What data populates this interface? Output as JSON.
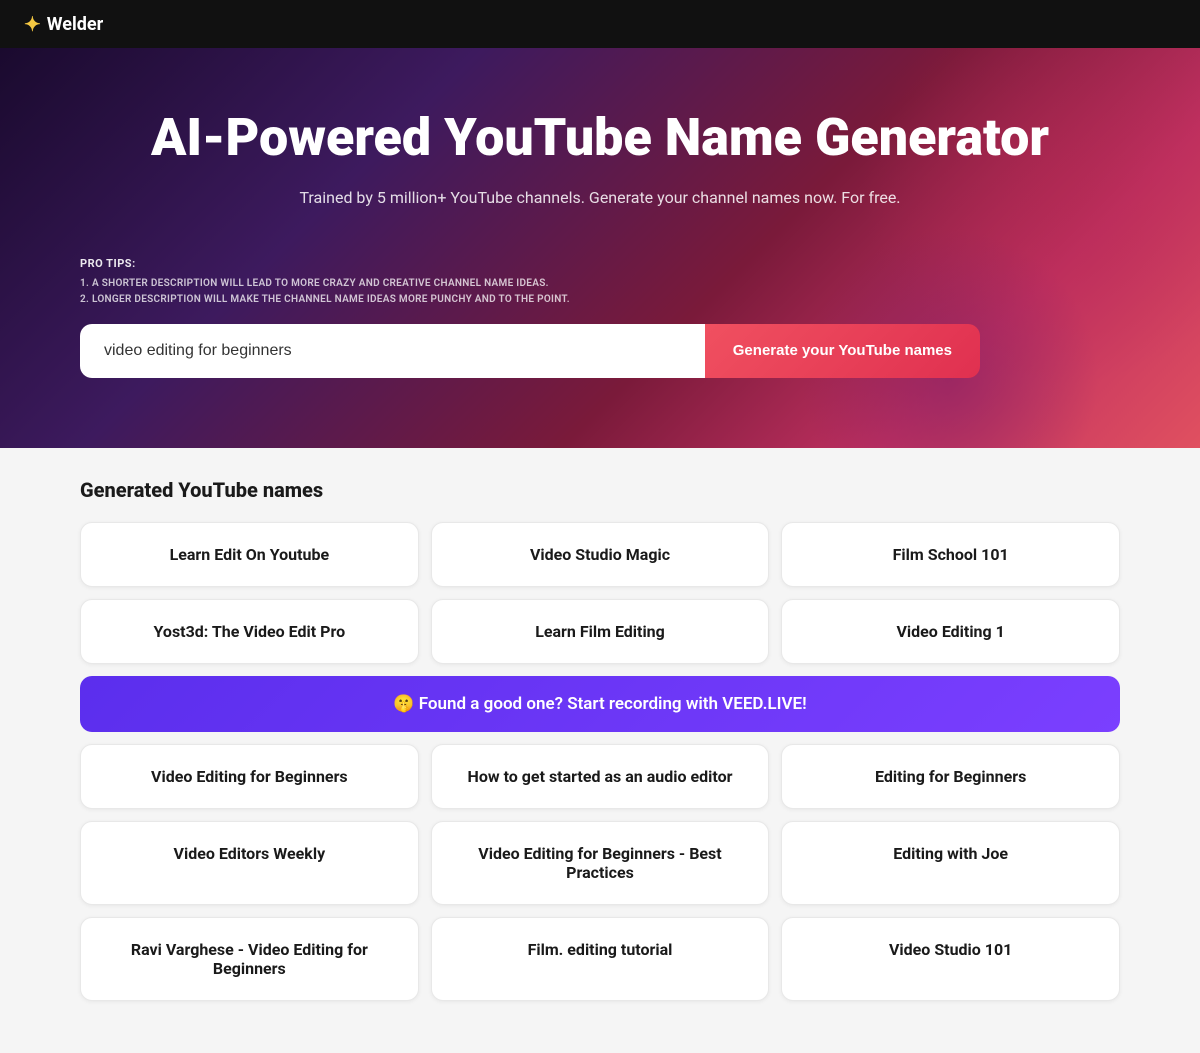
{
  "header": {
    "logo_icon": "✦",
    "logo_text": "Welder"
  },
  "hero": {
    "title": "AI-Powered YouTube Name Generator",
    "subtitle": "Trained by 5 million+ YouTube channels. Generate your channel names now. For free.",
    "pro_tips_label": "PRO TIPS:",
    "pro_tip_1": "1. A SHORTER DESCRIPTION WILL LEAD TO MORE CRAZY AND CREATIVE CHANNEL NAME IDEAS.",
    "pro_tip_2": "2. LONGER DESCRIPTION WILL MAKE THE CHANNEL NAME IDEAS MORE PUNCHY AND TO THE POINT.",
    "input_value": "video editing for beginners",
    "input_placeholder": "video editing for beginners",
    "generate_button": "Generate your YouTube names"
  },
  "results": {
    "section_title": "Generated YouTube names",
    "cta_text": "🤫 Found a good one? Start recording with VEED.LIVE!",
    "row1": [
      {
        "id": "card-1",
        "text": "Learn Edit On Youtube"
      },
      {
        "id": "card-2",
        "text": "Video Studio Magic"
      },
      {
        "id": "card-3",
        "text": "Film School 101"
      }
    ],
    "row2": [
      {
        "id": "card-4",
        "text": "Yost3d: The Video Edit Pro"
      },
      {
        "id": "card-5",
        "text": "Learn Film Editing"
      },
      {
        "id": "card-6",
        "text": "Video Editing 1"
      }
    ],
    "row3": [
      {
        "id": "card-7",
        "text": "Video Editing for Beginners"
      },
      {
        "id": "card-8",
        "text": "How to get started as an audio editor"
      },
      {
        "id": "card-9",
        "text": "Editing for Beginners"
      }
    ],
    "row4": [
      {
        "id": "card-10",
        "text": "Video Editors Weekly"
      },
      {
        "id": "card-11",
        "text": "Video Editing for Beginners - Best Practices"
      },
      {
        "id": "card-12",
        "text": "Editing with Joe"
      }
    ],
    "row5": [
      {
        "id": "card-13",
        "text": "Ravi Varghese - Video Editing for Beginners"
      },
      {
        "id": "card-14",
        "text": "Film. editing tutorial"
      },
      {
        "id": "card-15",
        "text": "Video Studio 101"
      }
    ]
  }
}
